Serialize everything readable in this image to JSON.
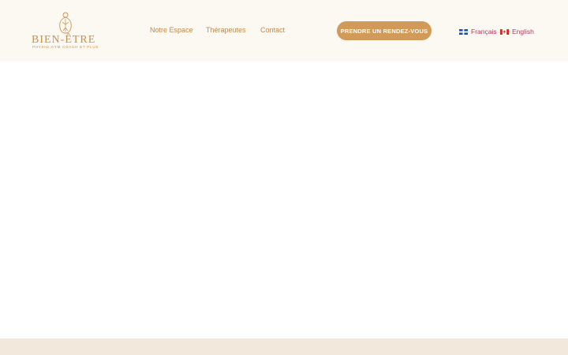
{
  "brand": {
    "name": "BIEN-ÊTRE",
    "tagline": "PHYSIO,GYM COACH ET PLUS"
  },
  "nav": {
    "items": [
      {
        "label": "Notre Espace"
      },
      {
        "label": "Thérapeutes"
      },
      {
        "label": "Contact"
      }
    ]
  },
  "cta": {
    "label": "PRENDRE UN RENDEZ-VOUS"
  },
  "languages": [
    {
      "label": "Français",
      "icon": "quebec-flag-icon"
    },
    {
      "label": "English",
      "icon": "canada-flag-icon"
    }
  ],
  "colors": {
    "header_bg": "#fcf8f2",
    "brand_gold": "#c9904c",
    "cta_bg": "#d29a58",
    "lang_text": "#b03a5e",
    "footer_bg": "#f3e8dc"
  }
}
